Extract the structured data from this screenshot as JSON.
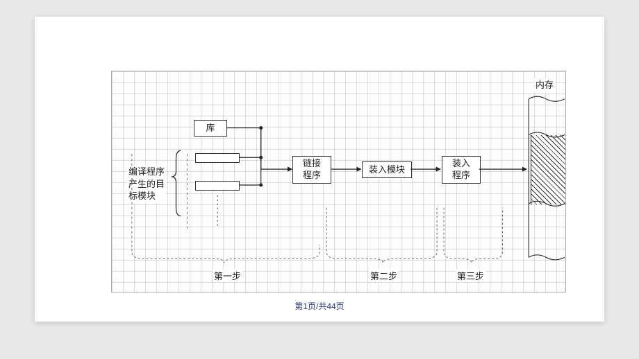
{
  "diagram": {
    "library": "库",
    "compiled_label": "编译程序\n产生的目\n标模块",
    "linker": "链接\n程序",
    "load_module": "装入模块",
    "loader": "装入\n程序",
    "memory_label": "内存",
    "steps": {
      "one": "第一步",
      "two": "第二步",
      "three": "第三步"
    }
  },
  "footer": {
    "page_indicator": "第1页/共44页"
  }
}
